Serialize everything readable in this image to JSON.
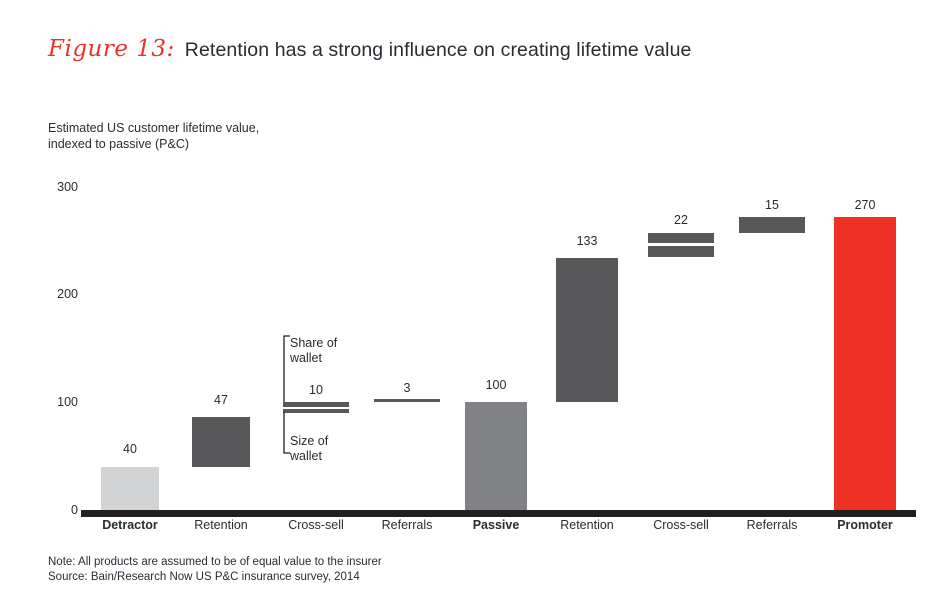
{
  "header": {
    "figure_label": "Figure 13:",
    "title": "Retention has a strong influence on creating lifetime value",
    "accent_color": "#ee3124"
  },
  "subtitle": {
    "line1": "Estimated US customer lifetime value,",
    "line2": "indexed to passive (P&C)"
  },
  "footer": {
    "note": "Note: All products are assumed to be of equal value to the insurer",
    "source": "Source: Bain/Research Now US P&C insurance survey, 2014"
  },
  "annotations": {
    "share_of_wallet": "Share of\nwallet",
    "size_of_wallet": "Size of\nwallet"
  },
  "chart_data": {
    "type": "bar",
    "subtype": "waterfall",
    "title": "Retention has a strong influence on creating lifetime value",
    "subtitle": "Estimated US customer lifetime value, indexed to passive (P&C)",
    "xlabel": "",
    "ylabel": "",
    "ylim": [
      0,
      300
    ],
    "yticks": [
      0,
      100,
      200,
      300
    ],
    "ytick_labels": [
      "0",
      "100",
      "200",
      "300"
    ],
    "grid": false,
    "legend": "none",
    "categories": [
      "Detractor",
      "Retention",
      "Cross-sell",
      "Referrals",
      "Passive",
      "Retention",
      "Cross-sell",
      "Referrals",
      "Promoter"
    ],
    "values": [
      40,
      47,
      10,
      3,
      100,
      133,
      22,
      15,
      270
    ],
    "value_labels": [
      "40",
      "47",
      "10",
      "3",
      "100",
      "133",
      "22",
      "15",
      "270"
    ],
    "bars": [
      {
        "category": "Detractor",
        "label": "40",
        "value": 40,
        "base": 0,
        "top": 40,
        "kind": "total",
        "color": "#d2d3d5",
        "emphasis": true
      },
      {
        "category": "Retention",
        "label": "47",
        "value": 47,
        "base": 40,
        "top": 87,
        "kind": "increment",
        "color": "#58585b",
        "emphasis": false
      },
      {
        "category": "Cross-sell",
        "label": "10",
        "value": 10,
        "base": 87,
        "top": 97,
        "kind": "increment-split",
        "color": "#58585b",
        "emphasis": false
      },
      {
        "category": "Referrals",
        "label": "3",
        "value": 3,
        "base": 97,
        "top": 100,
        "kind": "increment",
        "color": "#58585b",
        "emphasis": false
      },
      {
        "category": "Passive",
        "label": "100",
        "value": 100,
        "base": 0,
        "top": 100,
        "kind": "total",
        "color": "#808285",
        "emphasis": true
      },
      {
        "category": "Retention",
        "label": "133",
        "value": 133,
        "base": 100,
        "top": 233,
        "kind": "increment",
        "color": "#58585b",
        "emphasis": false
      },
      {
        "category": "Cross-sell",
        "label": "22",
        "value": 22,
        "base": 233,
        "top": 255,
        "kind": "increment-split",
        "color": "#58585b",
        "emphasis": false
      },
      {
        "category": "Referrals",
        "label": "15",
        "value": 15,
        "base": 255,
        "top": 270,
        "kind": "increment",
        "color": "#58585b",
        "emphasis": false
      },
      {
        "category": "Promoter",
        "label": "270",
        "value": 270,
        "base": 0,
        "top": 270,
        "kind": "total",
        "color": "#ee3124",
        "emphasis": true
      }
    ],
    "colors": {
      "total_light": "#d2d3d5",
      "total_mid": "#808285",
      "increment": "#58585b",
      "highlight_red": "#ee3124",
      "axis": "#231f20"
    },
    "annotations": [
      {
        "text": "Share of wallet",
        "target_category": "Cross-sell",
        "position": "above"
      },
      {
        "text": "Size of wallet",
        "target_category": "Cross-sell",
        "position": "below"
      }
    ]
  }
}
